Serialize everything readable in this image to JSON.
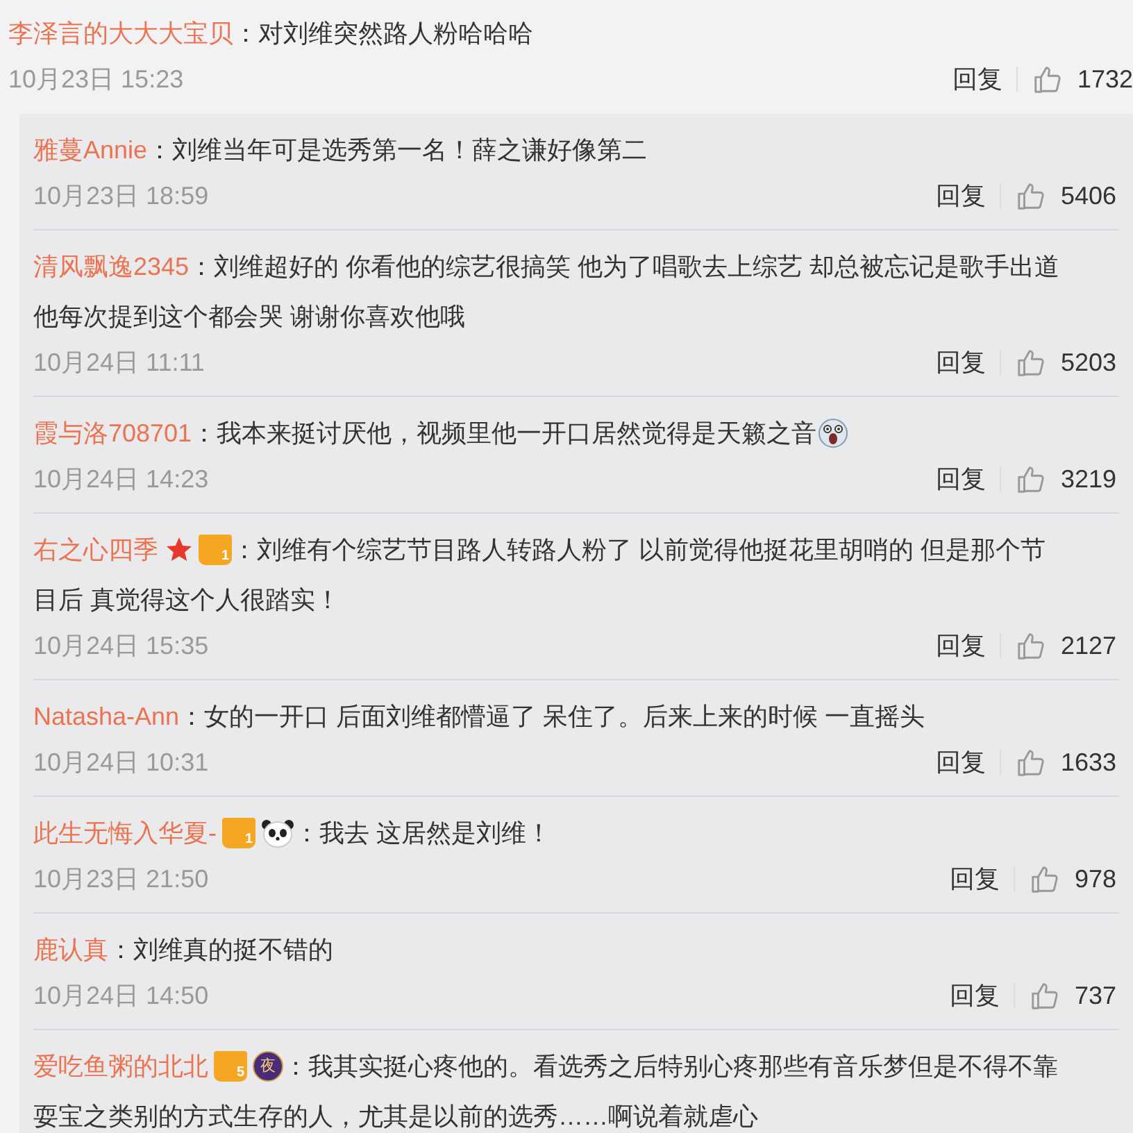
{
  "comment": {
    "user": "李泽言的大大大宝贝",
    "lines": [
      "：对刘维突然路人粉哈哈哈"
    ],
    "time": "10月23日 15:23",
    "reply_label": "回复",
    "likes": "1732"
  },
  "replies": [
    {
      "user": "雅蔓Annie",
      "lines": [
        "：刘维当年可是选秀第一名！薛之谦好像第二"
      ],
      "emoji": false,
      "time": "10月23日 18:59",
      "reply_label": "回复",
      "likes": "5406"
    },
    {
      "user": "清风飘逸2345",
      "lines": [
        "：刘维超好的 你看他的综艺很搞笑 他为了唱歌去上综艺 却总被忘记是歌手出道",
        "他每次提到这个都会哭 谢谢你喜欢他哦"
      ],
      "emoji": false,
      "time": "10月24日 11:11",
      "reply_label": "回复",
      "likes": "5203"
    },
    {
      "user": "霞与洛708701",
      "lines": [
        "：我本来挺讨厌他，视频里他一开口居然觉得是天籁之音"
      ],
      "emoji": true,
      "time": "10月24日 14:23",
      "reply_label": "回复",
      "likes": "3219"
    },
    {
      "user": "右之心四季",
      "badges": [
        {
          "kind": "star"
        },
        {
          "kind": "crown",
          "text": "1"
        }
      ],
      "lines": [
        "：刘维有个综艺节目路人转路人粉了 以前觉得他挺花里胡哨的 但是那个节",
        "目后 真觉得这个人很踏实！"
      ],
      "emoji": false,
      "time": "10月24日 15:35",
      "reply_label": "回复",
      "likes": "2127"
    },
    {
      "user": "Natasha-Ann",
      "lines": [
        "：女的一开口 后面刘维都懵逼了 呆住了。后来上来的时候 一直摇头"
      ],
      "emoji": false,
      "time": "10月24日 10:31",
      "reply_label": "回复",
      "likes": "1633"
    },
    {
      "user": "此生无悔入华夏-",
      "badges": [
        {
          "kind": "crown",
          "text": "1"
        },
        {
          "kind": "panda"
        }
      ],
      "lines": [
        "：我去 这居然是刘维！"
      ],
      "emoji": false,
      "time": "10月23日 21:50",
      "reply_label": "回复",
      "likes": "978"
    },
    {
      "user": "鹿认真",
      "lines": [
        "：刘维真的挺不错的"
      ],
      "emoji": false,
      "time": "10月24日 14:50",
      "reply_label": "回复",
      "likes": "737"
    },
    {
      "user": "爱吃鱼粥的北北",
      "badges": [
        {
          "kind": "crown",
          "text": "5"
        },
        {
          "kind": "night",
          "text": "夜"
        }
      ],
      "lines": [
        "：我其实挺心疼他的。看选秀之后特别心疼那些有音乐梦但是不得不靠",
        "耍宝之类别的方式生存的人，尤其是以前的选秀……啊说着就虐心"
      ],
      "emoji": false
    }
  ]
}
